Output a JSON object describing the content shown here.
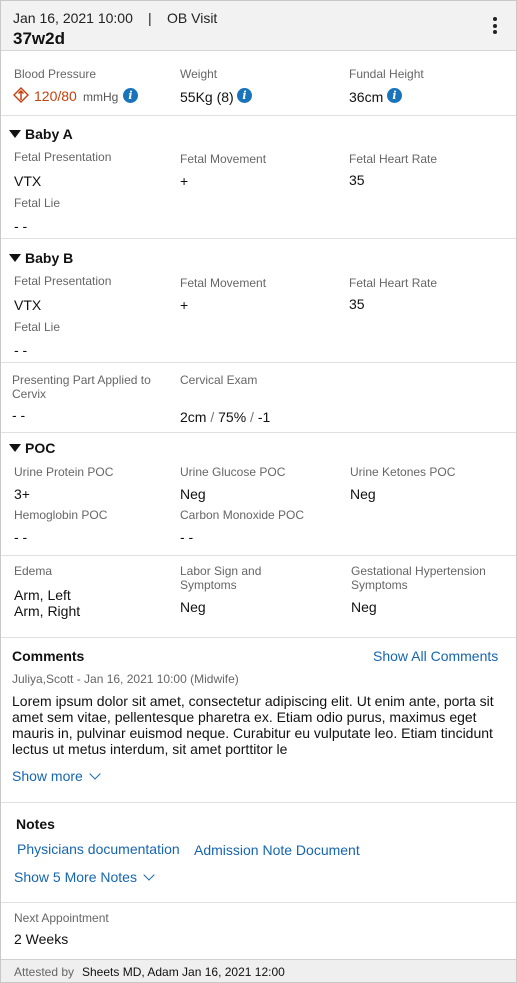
{
  "header": {
    "date": "Jan 16, 2021 10:00",
    "separator": "|",
    "visit_type": "OB Visit",
    "gestational_age": "37w2d"
  },
  "vitals": {
    "blood_pressure_label": "Blood Pressure",
    "blood_pressure_value": "120/80",
    "blood_pressure_unit": "mmHg",
    "weight_label": "Weight",
    "weight_value": "55Kg (8)",
    "fundal_label": "Fundal Height",
    "fundal_value": "36cm"
  },
  "info_glyph": "i",
  "baby_a": {
    "title": "Baby A",
    "fetal_presentation_label": "Fetal Presentation",
    "fetal_presentation_value": "VTX",
    "fetal_movement_label": "Fetal Movement",
    "fetal_movement_value": "+",
    "fetal_heart_rate_label": "Fetal Heart Rate",
    "fetal_heart_rate_value": "35",
    "fetal_lie_label": "Fetal Lie",
    "fetal_lie_value": "- -"
  },
  "baby_b": {
    "title": "Baby B",
    "fetal_presentation_label": "Fetal Presentation",
    "fetal_presentation_value": "VTX",
    "fetal_movement_label": "Fetal Movement",
    "fetal_movement_value": "+",
    "fetal_heart_rate_label": "Fetal Heart Rate",
    "fetal_heart_rate_value": "35",
    "fetal_lie_label": "Fetal Lie",
    "fetal_lie_value": "- -"
  },
  "cervix": {
    "presenting_part_label": "Presenting Part Applied to Cervix",
    "presenting_part_value": "- -",
    "cervical_exam_label": "Cervical Exam",
    "dilation": "2cm",
    "slash": "/",
    "effacement": "75%",
    "station": "-1"
  },
  "poc": {
    "title": "POC",
    "urine_protein_label": "Urine Protein POC",
    "urine_protein_value": "3+",
    "urine_glucose_label": "Urine Glucose POC",
    "urine_glucose_value": "Neg",
    "urine_ketones_label": "Urine Ketones POC",
    "urine_ketones_value": "Neg",
    "hemoglobin_label": "Hemoglobin POC",
    "hemoglobin_value": "- -",
    "carbon_monoxide_label": "Carbon Monoxide POC",
    "carbon_monoxide_value": "- -"
  },
  "symptoms": {
    "edema_label": "Edema",
    "edema_values": [
      "Arm, Left",
      "Arm, Right"
    ],
    "labor_label": "Labor Sign and Symptoms",
    "labor_value": "Neg",
    "gest_htn_label": "Gestational Hypertension Symptoms",
    "gest_htn_value": "Neg"
  },
  "comments": {
    "title": "Comments",
    "show_all": "Show All Comments",
    "author": "Juliya,Scott - Jan 16, 2021 10:00 (Midwife)",
    "body": "Lorem ipsum dolor sit amet, consectetur adipiscing elit. Ut enim ante, porta sit amet sem vitae, pellentesque pharetra ex. Etiam odio purus, maximus eget mauris in, pulvinar euismod neque. Curabitur eu vulputate leo. Etiam tincidunt lectus ut metus interdum, sit amet porttitor le",
    "show_more": "Show more"
  },
  "notes": {
    "title": "Notes",
    "links": [
      "Physicians documentation",
      "Admission Note Document"
    ],
    "show_more": "Show 5 More Notes"
  },
  "next_appointment": {
    "label": "Next Appointment",
    "value": "2 Weeks"
  },
  "footer": {
    "attested_label": "Attested by",
    "attested_value": "Sheets MD, Adam  Jan 16, 2021 12:00"
  },
  "colors": {
    "accent_link": "#1565b0",
    "info_icon": "#1a74bc",
    "bp_alert": "#c2410c"
  }
}
